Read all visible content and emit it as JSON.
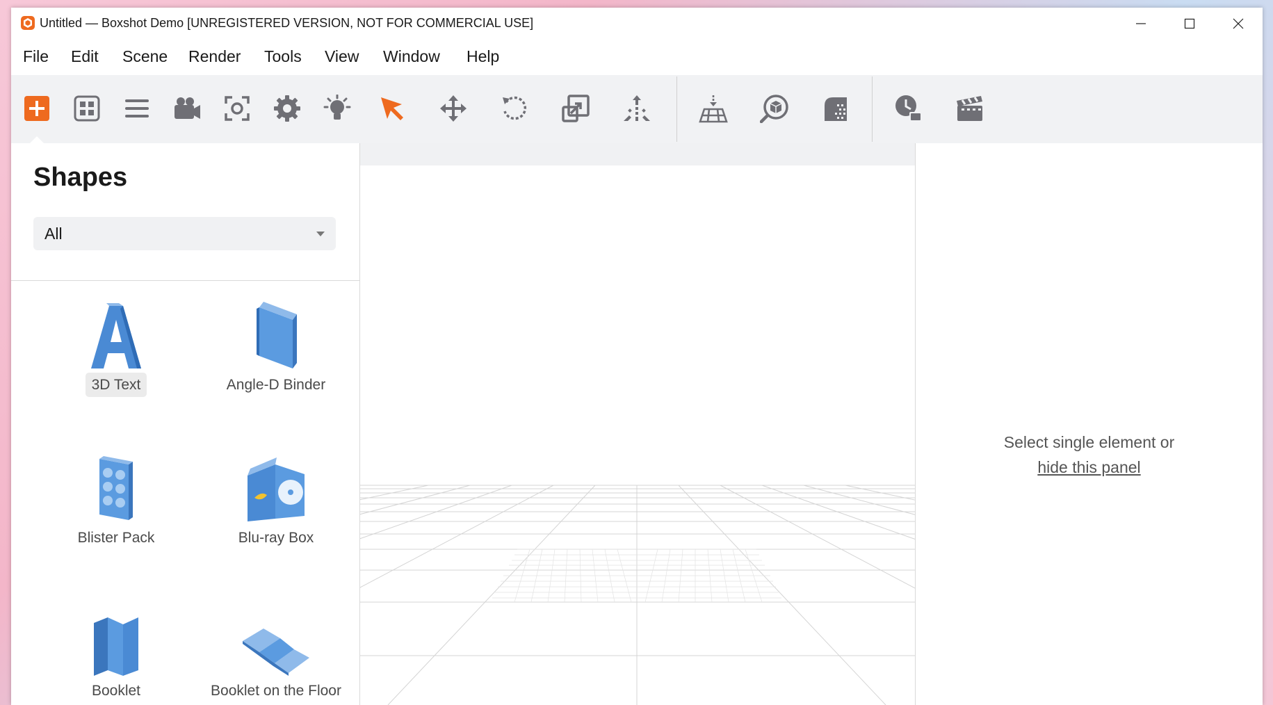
{
  "window": {
    "title": "Untitled — Boxshot Demo [UNREGISTERED VERSION, NOT FOR COMMERCIAL USE]",
    "app_icon": "boxshot-app-icon",
    "controls": [
      "minimize-icon",
      "maximize-icon",
      "close-icon"
    ]
  },
  "menu": {
    "items": [
      "File",
      "Edit",
      "Scene",
      "Render",
      "Tools",
      "View",
      "Window",
      "Help"
    ]
  },
  "toolbar": {
    "accent_color": "#ee6a1f",
    "tools": [
      {
        "icon": "add-icon",
        "active": true
      },
      {
        "icon": "layout-grid-icon"
      },
      {
        "icon": "list-icon"
      },
      {
        "icon": "camera-icon"
      },
      {
        "icon": "screenshot-focus-icon"
      },
      {
        "icon": "settings-gear-icon"
      },
      {
        "icon": "light-bulb-icon"
      },
      {
        "icon": "select-arrow-icon",
        "active": true
      },
      {
        "icon": "move-icon"
      },
      {
        "icon": "rotate-icon"
      },
      {
        "icon": "scale-icon"
      },
      {
        "icon": "drop-to-floor-icon"
      },
      {
        "icon": "ground-grid-icon"
      },
      {
        "icon": "zoom-object-icon"
      },
      {
        "icon": "material-icon"
      },
      {
        "icon": "render-time-icon"
      },
      {
        "icon": "animation-clapper-icon"
      }
    ]
  },
  "shapes_panel": {
    "title": "Shapes",
    "filter": {
      "selected": "All"
    },
    "items": [
      {
        "label": "3D Text",
        "selected": true
      },
      {
        "label": "Angle-D Binder"
      },
      {
        "label": "Blister Pack"
      },
      {
        "label": "Blu-ray Box"
      },
      {
        "label": "Booklet"
      },
      {
        "label": "Booklet on the Floor"
      }
    ]
  },
  "properties_panel": {
    "message": "Select single element or",
    "link": "hide this panel"
  }
}
